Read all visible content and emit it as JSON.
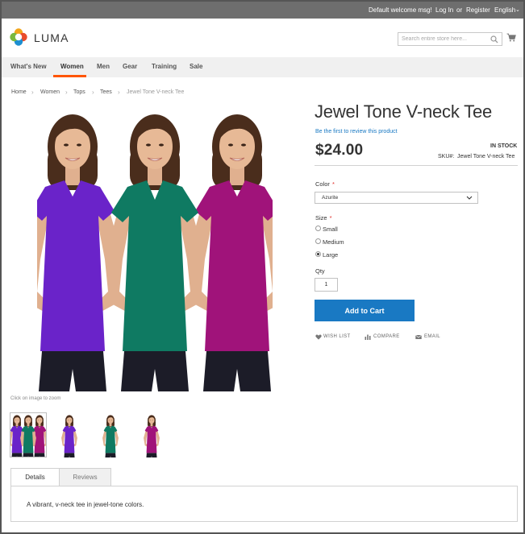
{
  "topbar": {
    "welcome": "Default welcome msg!",
    "login": "Log In",
    "or": "or",
    "register": "Register",
    "language": "English"
  },
  "header": {
    "logo_text": "LUMA",
    "search_placeholder": "Search entire store here...",
    "cart_icon": "cart-icon"
  },
  "nav": {
    "items": [
      "What's New",
      "Women",
      "Men",
      "Gear",
      "Training",
      "Sale"
    ],
    "active": "Women"
  },
  "breadcrumb": [
    "Home",
    "Women",
    "Tops",
    "Tees",
    "Jewel Tone V-neck Tee"
  ],
  "gallery": {
    "zoom_note": "Click on image to zoom",
    "colors": [
      "#6a23c9",
      "#0f7a62",
      "#a0137a"
    ]
  },
  "product": {
    "title": "Jewel Tone V-neck Tee",
    "review_link": "Be the first to review this product",
    "price": "$24.00",
    "stock": "IN STOCK",
    "sku_label": "SKU#:",
    "sku_value": "Jewel Tone V-neck Tee",
    "color_label": "Color",
    "color_value": "Azurite",
    "size_label": "Size",
    "sizes": [
      "Small",
      "Medium",
      "Large"
    ],
    "selected_size": "Large",
    "required_mark": "*",
    "qty_label": "Qty",
    "qty_value": "1",
    "add_to_cart": "Add to Cart",
    "wishlist": "WISH LIST",
    "compare": "COMPARE",
    "email": "EMAIL"
  },
  "tabs": {
    "details": "Details",
    "reviews": "Reviews",
    "details_text": "A vibrant, v-neck tee in jewel-tone colors."
  },
  "colors": {
    "accent": "#1979c3",
    "nav_active": "#ff5501",
    "topbar": "#6e6e6e"
  }
}
